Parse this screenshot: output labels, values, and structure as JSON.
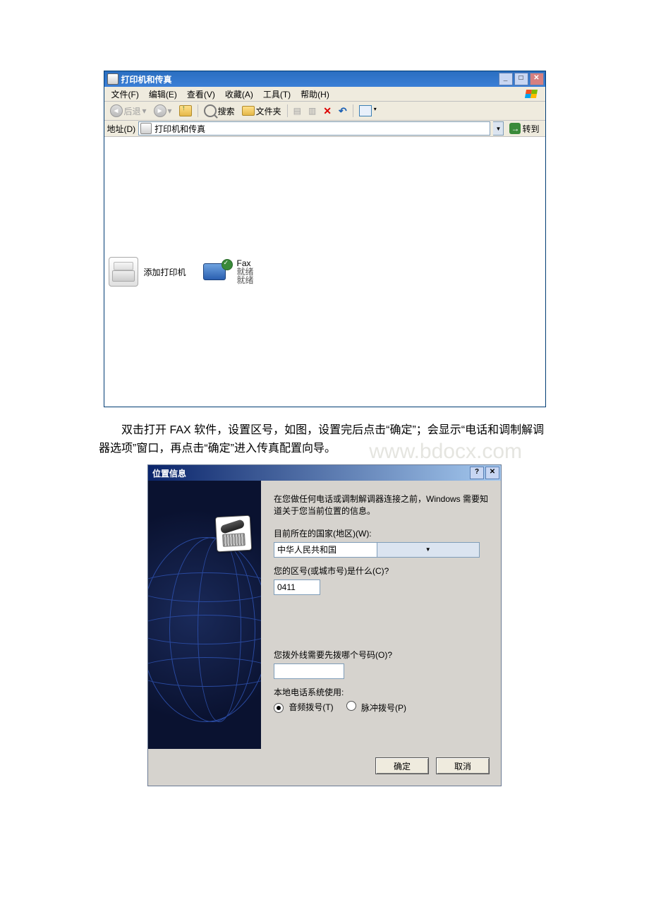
{
  "window1": {
    "title": "打印机和传真",
    "menu": [
      "文件(F)",
      "编辑(E)",
      "查看(V)",
      "收藏(A)",
      "工具(T)",
      "帮助(H)"
    ],
    "toolbar": {
      "back": "后退",
      "search": "搜索",
      "folders": "文件夹"
    },
    "address": {
      "label": "地址(D)",
      "value": "打印机和传真",
      "go": "转到"
    },
    "items": {
      "add_printer": "添加打印机",
      "fax_label_top": "Fax",
      "fax_label_bottom": "就绪"
    }
  },
  "paragraph": "双击打开 FAX 软件，设置区号，如图，设置完后点击“确定”；会显示“电话和调制解调器选项”窗口，再点击“确定”进入传真配置向导。",
  "watermark": "www.bdocx.com",
  "dialog": {
    "title": "位置信息",
    "intro": "在您做任何电话或调制解调器连接之前，Windows 需要知道关于您当前位置的信息。",
    "country_label": "目前所在的国家(地区)(W):",
    "country_value": "中华人民共和国",
    "area_label": "您的区号(或城市号)是什么(C)?",
    "area_value": "0411",
    "outside_label": "您拨外线需要先拨哪个号码(O)?",
    "outside_value": "",
    "system_label": "本地电话系统使用:",
    "radio_tone": "音频拨号(T)",
    "radio_pulse": "脉冲拨号(P)",
    "ok": "确定",
    "cancel": "取消"
  }
}
